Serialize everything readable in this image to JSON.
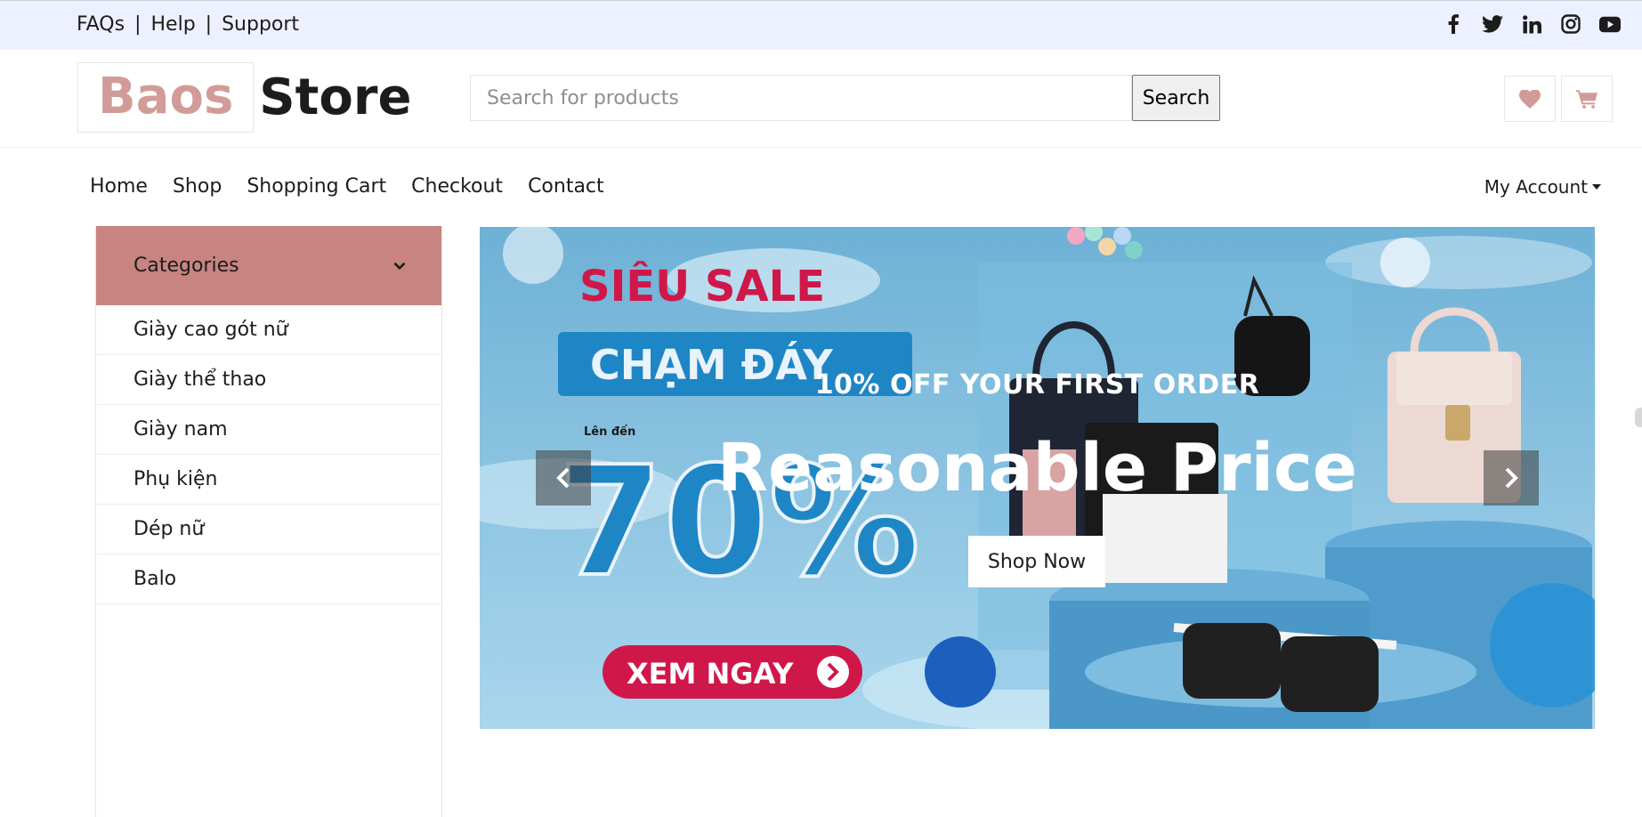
{
  "topbar": {
    "links": [
      "FAQs",
      "Help",
      "Support"
    ],
    "separator": "|",
    "social_icons": [
      "facebook-icon",
      "twitter-icon",
      "linkedin-icon",
      "instagram-icon",
      "youtube-icon"
    ]
  },
  "header": {
    "logo_part1": "Baos",
    "logo_part2": "Store",
    "search_placeholder": "Search for products",
    "search_button": "Search",
    "icons": [
      "heart-icon",
      "cart-icon"
    ]
  },
  "nav": {
    "items": [
      "Home",
      "Shop",
      "Shopping Cart",
      "Checkout",
      "Contact"
    ],
    "account": "My Account"
  },
  "sidebar": {
    "title": "Categories",
    "items": [
      "Giày cao gót nữ",
      "Giày thể thao",
      "Giày nam",
      "Phụ kiện",
      "Dép nữ",
      "Balo"
    ]
  },
  "carousel": {
    "subtitle": "10% OFF YOUR FIRST ORDER",
    "title": "Reasonable Price",
    "button": "Shop Now",
    "banner_text": {
      "line1": "SIÊU SALE",
      "line2": "CHẠM ĐÁY",
      "upto": "Lên đến",
      "percent": "70%",
      "cta": "XEM NGAY"
    }
  },
  "colors": {
    "primary": "#d19c97",
    "category_header": "#c88480",
    "topbar": "#edf1ff",
    "banner_sky": "#79b6d6",
    "banner_red": "#d0174a",
    "banner_blue": "#1e86c5"
  }
}
